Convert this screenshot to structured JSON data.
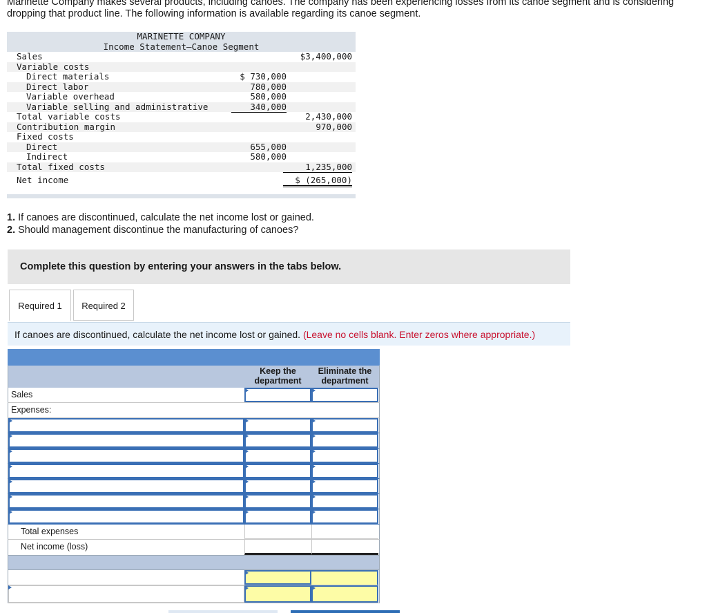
{
  "intro": "Marinette Company makes several products, including canoes. The company has been experiencing losses from its canoe segment and is considering dropping that product line. The following information is available regarding its canoe segment.",
  "statement": {
    "company": "MARINETTE COMPANY",
    "title": "Income Statement—Canoe Segment",
    "rows": [
      {
        "label": "Sales",
        "c1": "",
        "c2": "$3,400,000",
        "indent": 0
      },
      {
        "label": "Variable costs",
        "c1": "",
        "c2": "",
        "indent": 0
      },
      {
        "label": "Direct materials",
        "c1": "$ 730,000",
        "c2": "",
        "indent": 1
      },
      {
        "label": "Direct labor",
        "c1": "780,000",
        "c2": "",
        "indent": 1
      },
      {
        "label": "Variable overhead",
        "c1": "580,000",
        "c2": "",
        "indent": 1
      },
      {
        "label": "Variable selling and administrative",
        "c1": "340,000",
        "c2": "",
        "indent": 1
      },
      {
        "label": "Total variable costs",
        "c1": "",
        "c2": "2,430,000",
        "indent": 0
      },
      {
        "label": "Contribution margin",
        "c1": "",
        "c2": "970,000",
        "indent": 0
      },
      {
        "label": "Fixed costs",
        "c1": "",
        "c2": "",
        "indent": 0
      },
      {
        "label": "Direct",
        "c1": "655,000",
        "c2": "",
        "indent": 1
      },
      {
        "label": "Indirect",
        "c1": "580,000",
        "c2": "",
        "indent": 1
      },
      {
        "label": "Total fixed costs",
        "c1": "",
        "c2": "1,235,000",
        "indent": 0
      },
      {
        "label": "Net income",
        "c1": "",
        "c2": "$ (265,000)",
        "indent": 0
      }
    ]
  },
  "questions": {
    "q1_num": "1.",
    "q1": " If canoes are discontinued, calculate the net income lost or gained.",
    "q2_num": "2.",
    "q2": " Should management discontinue the manufacturing of canoes?"
  },
  "banner": "Complete this question by entering your answers in the tabs below.",
  "tabs": [
    {
      "label": "Required 1"
    },
    {
      "label": "Required 2"
    }
  ],
  "instruction": {
    "text": "If canoes are discontinued, calculate the net income lost or gained.",
    "note": "(Leave no cells blank. Enter zeros where appropriate.)"
  },
  "answer_table": {
    "col_keep": "Keep the department",
    "col_eliminate": "Eliminate the department",
    "sales_label": "Sales",
    "expenses_label": "Expenses:",
    "total_expenses_label": "Total expenses",
    "net_income_label": "Net income (loss)"
  }
}
